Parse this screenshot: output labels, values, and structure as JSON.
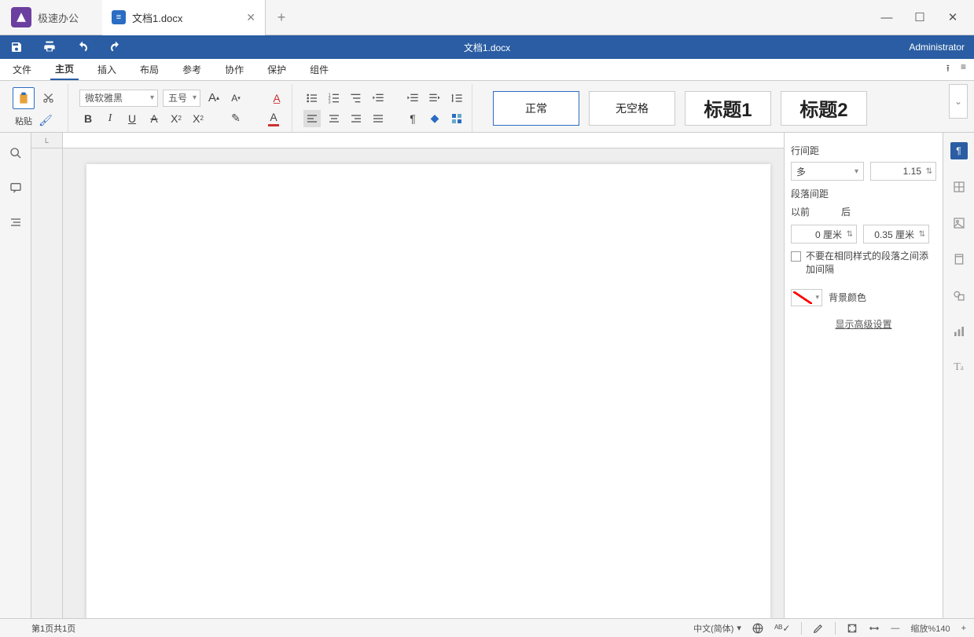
{
  "app": {
    "name": "极速办公"
  },
  "tab": {
    "label": "文档1.docx"
  },
  "quick": {
    "doc_title": "文档1.docx",
    "admin": "Administrator"
  },
  "menus": {
    "file": "文件",
    "home": "主页",
    "insert": "插入",
    "layout": "布局",
    "refs": "参考",
    "collab": "协作",
    "protect": "保护",
    "group": "组件"
  },
  "ribbon": {
    "paste": "粘贴",
    "font_name": "微软雅黑",
    "font_size": "五号",
    "styles": {
      "normal": "正常",
      "nospace": "无空格",
      "h1": "标题1",
      "h2": "标题2"
    }
  },
  "inspector": {
    "line_spacing": "行间距",
    "multi": "多",
    "multi_val": "1.15",
    "para_spacing": "段落间距",
    "before": "以前",
    "after": "后",
    "before_val": "0 厘米",
    "after_val": "0.35 厘米",
    "dont_add": "不要在相同样式的段落之间添加间隔",
    "bg_color": "背景颜色",
    "advanced": "显示高级设置"
  },
  "status": {
    "page": "第1页共1页",
    "lang": "中文(简体)",
    "zoom": "缩放%140"
  }
}
